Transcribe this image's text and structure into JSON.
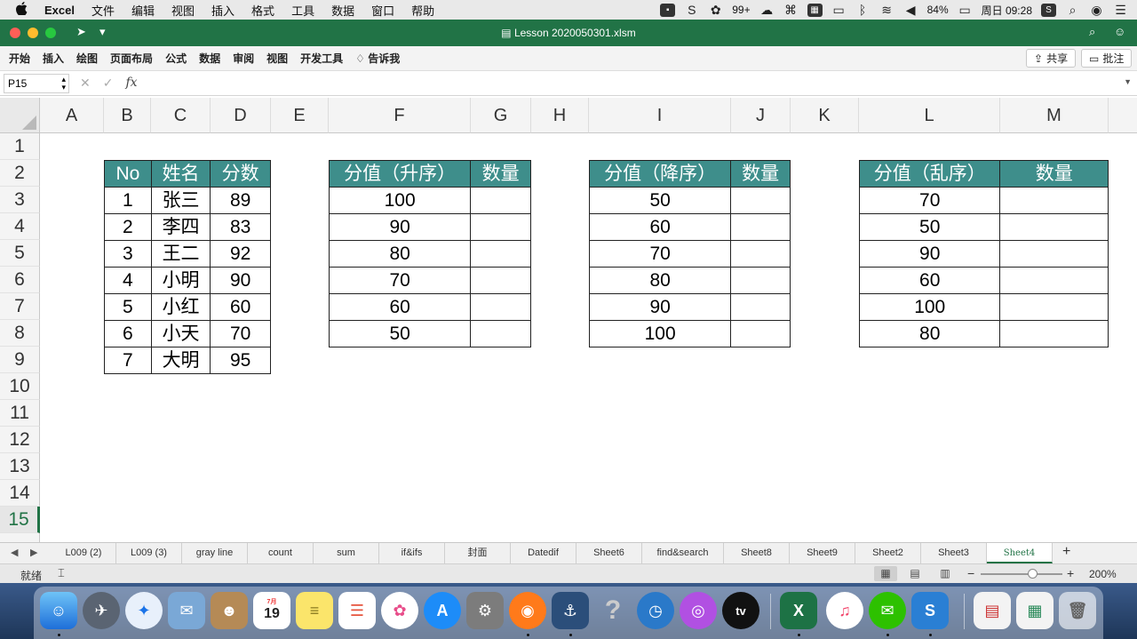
{
  "menubar": {
    "apple": "",
    "items": [
      "Excel",
      "文件",
      "编辑",
      "视图",
      "插入",
      "格式",
      "工具",
      "数据",
      "窗口",
      "帮助"
    ],
    "status": {
      "badge": "99+",
      "battery": "84%",
      "clock": "周日 09:28"
    }
  },
  "titlebar": {
    "document": "Lesson 2020050301.xlsm"
  },
  "ribbon": {
    "tabs": [
      "开始",
      "插入",
      "绘图",
      "页面布局",
      "公式",
      "数据",
      "审阅",
      "视图",
      "开发工具"
    ],
    "tell_me": "告诉我",
    "share": "共享",
    "comment": "批注"
  },
  "formula_bar": {
    "name_box": "P15",
    "fx": "fx",
    "value": ""
  },
  "grid": {
    "columns": [
      "A",
      "B",
      "C",
      "D",
      "E",
      "F",
      "G",
      "H",
      "I",
      "J",
      "K",
      "L",
      "M"
    ],
    "rows": [
      "1",
      "2",
      "3",
      "4",
      "5",
      "6",
      "7",
      "8",
      "9",
      "10",
      "11",
      "12",
      "13",
      "14",
      "15"
    ],
    "active_row": "15"
  },
  "table_students": {
    "headers": [
      "No",
      "姓名",
      "分数"
    ],
    "rows": [
      [
        "1",
        "张三",
        "89"
      ],
      [
        "2",
        "李四",
        "83"
      ],
      [
        "3",
        "王二",
        "92"
      ],
      [
        "4",
        "小明",
        "90"
      ],
      [
        "5",
        "小红",
        "60"
      ],
      [
        "6",
        "小天",
        "70"
      ],
      [
        "7",
        "大明",
        "95"
      ]
    ]
  },
  "table_asc": {
    "headers": [
      "分值（升序）",
      "数量"
    ],
    "values": [
      "100",
      "90",
      "80",
      "70",
      "60",
      "50"
    ]
  },
  "table_desc": {
    "headers": [
      "分值（降序）",
      "数量"
    ],
    "values": [
      "50",
      "60",
      "70",
      "80",
      "90",
      "100"
    ]
  },
  "table_random": {
    "headers": [
      "分值（乱序）",
      "数量"
    ],
    "values": [
      "70",
      "50",
      "90",
      "60",
      "100",
      "80"
    ]
  },
  "sheets": {
    "tabs": [
      "L009 (2)",
      "L009 (3)",
      "gray line",
      "count",
      "sum",
      "if&ifs",
      "封面",
      "Datedif",
      "Sheet6",
      "find&search",
      "Sheet8",
      "Sheet9",
      "Sheet2",
      "Sheet3",
      "Sheet4"
    ],
    "active": "Sheet4",
    "add": "+"
  },
  "statusbar": {
    "ready": "就绪",
    "zoom_minus": "−",
    "zoom_plus": "+",
    "zoom": "200%"
  },
  "dock": {
    "calendar_month": "7月",
    "calendar_day": "19",
    "appletv_label": "tv"
  },
  "colors": {
    "excel_green": "#217346",
    "table_header": "#3e8e8b"
  }
}
